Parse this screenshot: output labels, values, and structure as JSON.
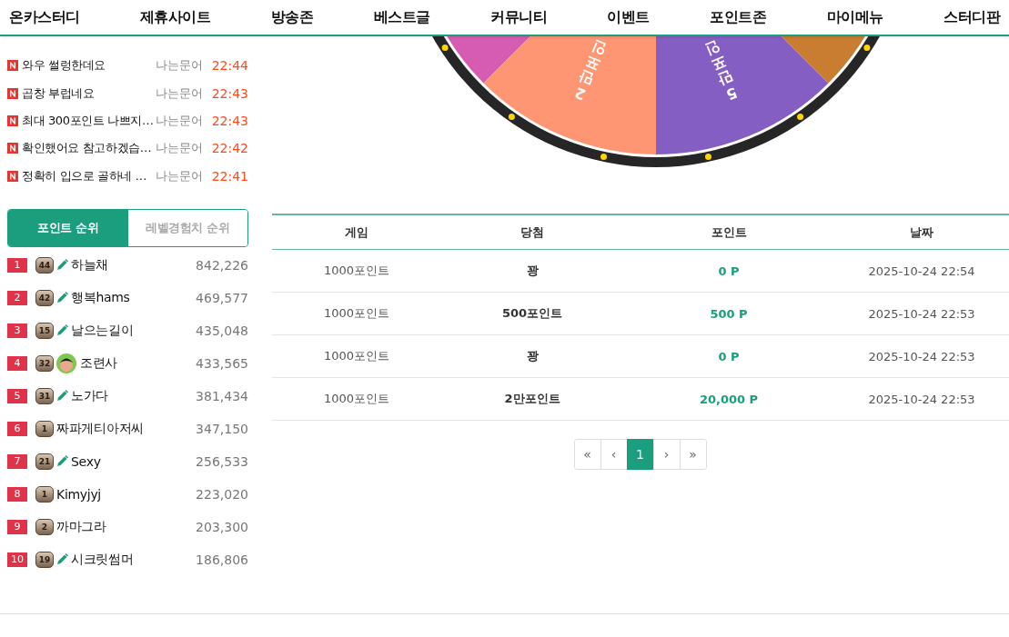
{
  "nav": [
    {
      "label": "온카스터디"
    },
    {
      "label": "제휴사이트"
    },
    {
      "label": "방송존"
    },
    {
      "label": "베스트글"
    },
    {
      "label": "커뮤니티"
    },
    {
      "label": "이벤트"
    },
    {
      "label": "포인트존"
    },
    {
      "label": "마이메뉴"
    },
    {
      "label": "스터디판"
    }
  ],
  "posts": [
    {
      "title": "와우 썰렁한데요",
      "author": "나는문어",
      "time": "22:44"
    },
    {
      "title": "곱창 부럽네요",
      "author": "나는문어",
      "time": "22:43"
    },
    {
      "title": "최대 300포인트 나쁘지…",
      "author": "나는문어",
      "time": "22:43"
    },
    {
      "title": "확인했어요 참고하겠습…",
      "author": "나는문어",
      "time": "22:42"
    },
    {
      "title": "정확히 입으로 골하네 …",
      "author": "나는문어",
      "time": "22:41"
    }
  ],
  "ranking_tabs": [
    {
      "label": "포인트 순위",
      "selected": true
    },
    {
      "label": "레벨경험치 순위",
      "selected": false
    }
  ],
  "ranking": [
    {
      "rank": "1",
      "level": "44",
      "kind": "pencil",
      "name": "하늘채",
      "points": "842,226"
    },
    {
      "rank": "2",
      "level": "42",
      "kind": "pencil",
      "name": "행복hams",
      "points": "469,577"
    },
    {
      "rank": "3",
      "level": "15",
      "kind": "pencil",
      "name": "날으는길이",
      "points": "435,048"
    },
    {
      "rank": "4",
      "level": "32",
      "kind": "avatar",
      "name": "조련사",
      "points": "433,565"
    },
    {
      "rank": "5",
      "level": "31",
      "kind": "pencil",
      "name": "노가다",
      "points": "381,434"
    },
    {
      "rank": "6",
      "level": "1",
      "kind": "plain",
      "name": "짜파게티아저씨",
      "points": "347,150"
    },
    {
      "rank": "7",
      "level": "21",
      "kind": "pencil",
      "name": "Sexy",
      "points": "256,533"
    },
    {
      "rank": "8",
      "level": "1",
      "kind": "plain",
      "name": "Kimyjyj",
      "points": "223,020"
    },
    {
      "rank": "9",
      "level": "2",
      "kind": "plain",
      "name": "까마그라",
      "points": "203,300"
    },
    {
      "rank": "10",
      "level": "19",
      "kind": "pencil",
      "name": "시크릿썸머",
      "points": "186,806"
    }
  ],
  "wheel": {
    "segments": [
      {
        "color": "#d65cb1"
      },
      {
        "label": "2만포인",
        "color": "#fe9573"
      },
      {
        "label": "5만포인",
        "color": "#845ec2"
      },
      {
        "color": "#c97d31"
      }
    ]
  },
  "table": {
    "columns": [
      "게임",
      "당첨",
      "포인트",
      "날짜"
    ],
    "rows": [
      {
        "game": "1000포인트",
        "prize": "꽝",
        "points": "0 P",
        "date": "2025-10-24 22:54"
      },
      {
        "game": "1000포인트",
        "prize": "500포인트",
        "points": "500 P",
        "date": "2025-10-24 22:53"
      },
      {
        "game": "1000포인트",
        "prize": "꽝",
        "points": "0 P",
        "date": "2025-10-24 22:53"
      },
      {
        "game": "1000포인트",
        "prize": "2만포인트",
        "points": "20,000 P",
        "date": "2025-10-24 22:53"
      }
    ]
  },
  "pagination": [
    {
      "label": "«",
      "selected": false
    },
    {
      "label": "‹",
      "selected": false
    },
    {
      "label": "1",
      "selected": true
    },
    {
      "label": "›",
      "selected": false
    },
    {
      "label": "»",
      "selected": false
    }
  ]
}
